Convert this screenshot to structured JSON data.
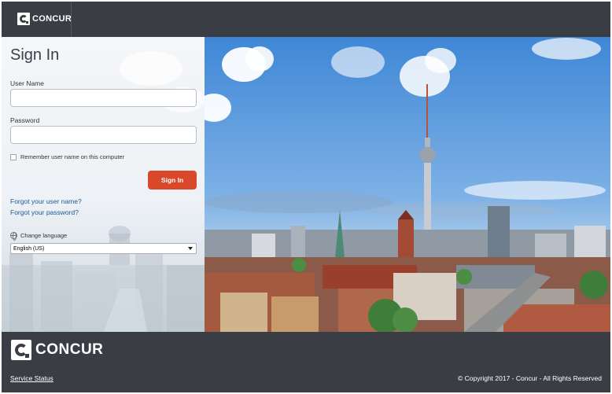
{
  "header": {
    "logo_text": "CONCUR"
  },
  "signin": {
    "title": "Sign In",
    "username_label": "User Name",
    "username_value": "",
    "password_label": "Password",
    "password_value": "",
    "remember_label": "Remember user name on this computer",
    "button_label": "Sign In",
    "forgot_username": "Forgot your user name?",
    "forgot_password": "Forgot your password?",
    "change_language_label": "Change language",
    "language_selected": "English (US)"
  },
  "footer": {
    "logo_text": "CONCUR",
    "service_status": "Service Status",
    "copyright": "© Copyright 2017 - Concur - All Rights Reserved"
  },
  "colors": {
    "chrome": "#3a3e44",
    "accent_button": "#d9482b",
    "link": "#1a5a9a"
  },
  "icons": [
    "concur-logo-icon",
    "globe-icon",
    "chevron-down-icon",
    "checkbox-icon"
  ]
}
